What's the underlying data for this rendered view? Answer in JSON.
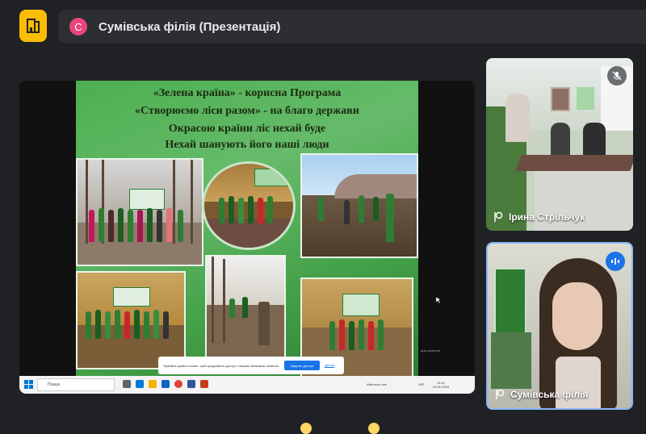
{
  "meeting": {
    "presenter_initial": "С",
    "title": "Сумівська філія (Презентація)"
  },
  "slide": {
    "lines": [
      "«Зелена країна» - корисна Програма",
      "«Створюємо ліси разом» - на благо держави",
      "Окрасою країни ліс нехай буде",
      "Нехай шанують його наші люди"
    ]
  },
  "cookie_notice": {
    "text": "Прийміть файли cookie, щоб продовжити доступ з вашим обліковим записом",
    "accept_label": "Закрить доступ",
    "more_label": "Деталі"
  },
  "taskbar": {
    "search_placeholder": "Пошук",
    "weather": "Afternoon rain",
    "lang": "УКР",
    "time": "11:41",
    "date": "03.01.2023"
  },
  "watermark": "quiz.sumy.net",
  "participants": [
    {
      "name": "Ірина Стрільчук",
      "muted": true
    },
    {
      "name": "Сумівська філія",
      "speaking": true
    }
  ],
  "colors": {
    "background": "#202124",
    "accent": "#1a73e8",
    "logo": "#fbbc04",
    "avatar": "#e8457a"
  }
}
